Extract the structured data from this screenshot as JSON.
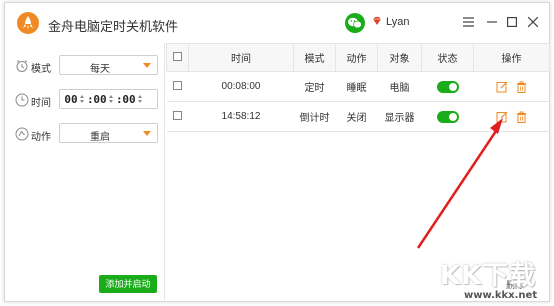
{
  "window": {
    "title": "金舟电脑定时关机软件"
  },
  "header": {
    "user_name": "Lyan",
    "menu_icon": "menu-icon",
    "min_icon": "minimize-icon",
    "max_icon": "maximize-icon",
    "close_icon": "close-icon"
  },
  "left_panel": {
    "mode": {
      "label": "模式",
      "value": "每天"
    },
    "time": {
      "label": "时间",
      "hour": "00",
      "minute": "00",
      "second": "00"
    },
    "action": {
      "label": "动作",
      "value": "重启"
    },
    "add_button": "添加并启动"
  },
  "table": {
    "headers": [
      "时间",
      "模式",
      "动作",
      "对象",
      "状态",
      "操作"
    ],
    "rows": [
      {
        "time": "00:08:00",
        "mode": "定时",
        "action": "睡眠",
        "target": "电脑",
        "enabled": true
      },
      {
        "time": "14:58:12",
        "mode": "倒计时",
        "action": "关闭",
        "target": "显示器",
        "enabled": true
      }
    ],
    "delete_label": "删除"
  },
  "watermark": {
    "text": "KK下载",
    "url": "www.kkx.net"
  },
  "colors": {
    "accent": "#f08a24",
    "green": "#1aad19",
    "arrow": "#e02020"
  }
}
